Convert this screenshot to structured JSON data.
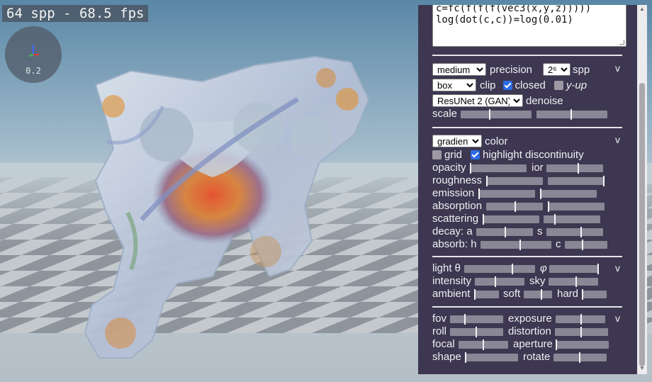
{
  "fps": "64 spp - 68.5 fps",
  "gizmo": {
    "value": "0.2"
  },
  "editor": {
    "lines": [
      "c=fc(f(f(f(vec3(x,y,z)))))",
      "log(dot(c,c))=log(0.01)"
    ]
  },
  "render": {
    "quality": {
      "selected": "medium",
      "label": "precision"
    },
    "spp": {
      "selected": "2⁶",
      "label": "spp"
    },
    "clip": {
      "selected": "box",
      "label": "clip"
    },
    "closed": {
      "label": "closed",
      "checked": true
    },
    "yup": {
      "label": "y-up",
      "checked": false
    },
    "denoise": {
      "selected": "ResUNet 2 (GAN)",
      "label": "denoise"
    },
    "scale": {
      "label": "scale",
      "values": [
        0.5,
        0.5
      ]
    },
    "collapse": "v"
  },
  "material": {
    "color": {
      "selected": "gradient",
      "label": "color"
    },
    "grid": {
      "label": "grid",
      "checked": false
    },
    "highlight": {
      "label": "highlight discontinuity",
      "checked": true
    },
    "collapse": "v",
    "opacity": {
      "label": "opacity",
      "value": 0.0
    },
    "ior": {
      "label": "ior",
      "value": 0.55
    },
    "roughness": {
      "label": "roughness",
      "value": 0.0
    },
    "roughness2": {
      "value": 1.0
    },
    "emission": {
      "label": "emission",
      "value": 0.0
    },
    "emission2": {
      "value": 0.0
    },
    "absorption": {
      "label": "absorption",
      "value": 0.5
    },
    "absorption2": {
      "value": 0.0
    },
    "scattering": {
      "label": "scattering",
      "value": 0.0
    },
    "scattering2": {
      "value": 0.2
    },
    "decay_a": {
      "label": "decay: a",
      "value": 0.5
    },
    "decay_s": {
      "label": "s",
      "value": 0.6
    },
    "absorb_h": {
      "label": "absorb: h",
      "value": 0.55
    },
    "absorb_c": {
      "label": "c",
      "value": 0.4
    }
  },
  "lighting": {
    "collapse": "v",
    "light_theta": {
      "label": "light θ",
      "value": 0.67
    },
    "light_phi": {
      "label": "φ",
      "value": 1.0
    },
    "intensity": {
      "label": "intensity",
      "value": 0.4
    },
    "sky": {
      "label": "sky",
      "value": 0.55
    },
    "ambient": {
      "label": "ambient",
      "value": 0.0
    },
    "soft": {
      "label": "soft",
      "value": 0.6
    },
    "hard": {
      "label": "hard",
      "value": 0.0
    }
  },
  "camera": {
    "collapse": "v",
    "fov": {
      "label": "fov",
      "value": 0.27
    },
    "exposure": {
      "label": "exposure",
      "value": 0.5
    },
    "roll": {
      "label": "roll",
      "value": 0.5
    },
    "distortion": {
      "label": "distortion",
      "value": 0.5
    },
    "focal": {
      "label": "focal",
      "value": 0.5
    },
    "aperture": {
      "label": "aperture",
      "value": 0.0
    },
    "shape": {
      "label": "shape",
      "value": 0.0
    },
    "rotate": {
      "label": "rotate",
      "value": 0.5
    }
  },
  "colors": {
    "panel": "#3d3751",
    "slider_track": "#898795",
    "checkbox_on": "#2b6be3"
  }
}
